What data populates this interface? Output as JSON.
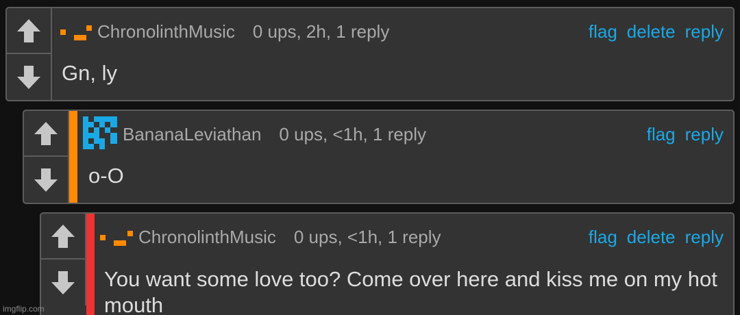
{
  "comments": [
    {
      "username": "ChronolinthMusic",
      "meta": "0 ups, 2h, 1 reply",
      "text": "Gn, ly",
      "actions": [
        "flag",
        "delete",
        "reply"
      ]
    },
    {
      "username": "BananaLeviathan",
      "meta": "0 ups, <1h, 1 reply",
      "text": "o-O",
      "actions": [
        "flag",
        "reply"
      ]
    },
    {
      "username": "ChronolinthMusic",
      "meta": "0 ups, <1h, 1 reply",
      "text": "You want some love too? Come over here and kiss me on my hot mouth",
      "actions": [
        "flag",
        "delete",
        "reply"
      ]
    }
  ],
  "icons": {
    "upvote": "up-arrow-icon",
    "downvote": "down-arrow-icon"
  },
  "colors": {
    "link": "#19a9e6",
    "depth_2": "#ff8a00",
    "depth_3": "#f03232",
    "avatar_orange": "#ff8a00",
    "avatar_blue": "#19a9e6"
  },
  "watermark": "imgflip.com"
}
